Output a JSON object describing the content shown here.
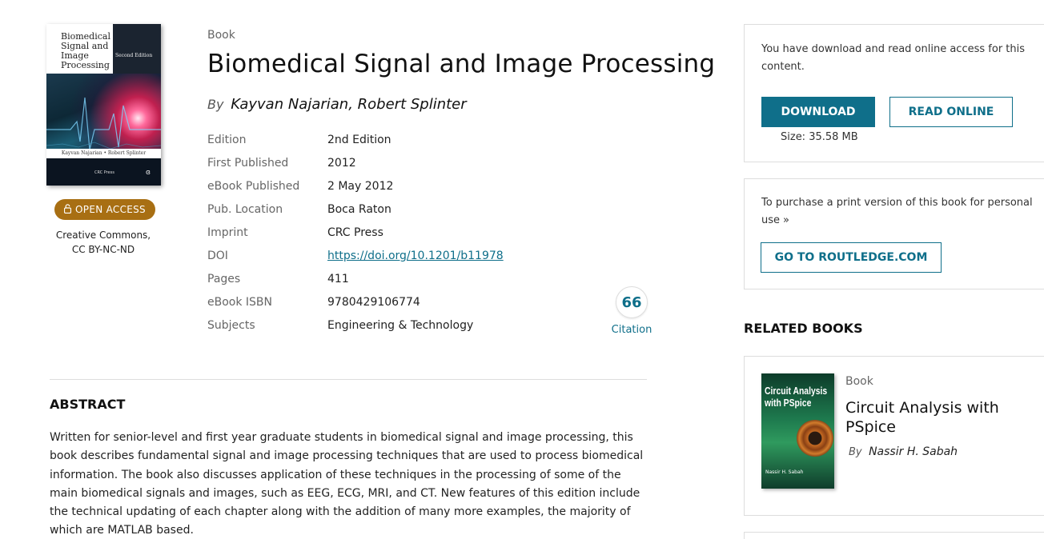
{
  "cover": {
    "title_lines": "Biomedical Signal and Image Processing",
    "edition_text": "Second Edition",
    "authors_text": "Kayvan Najarian • Robert Splinter",
    "publisher_text": "CRC Press"
  },
  "access_badge": {
    "label": "OPEN ACCESS",
    "icon": "lock-open-icon"
  },
  "license": {
    "line1": "Creative Commons,",
    "line2": "CC BY-NC-ND"
  },
  "book": {
    "type": "Book",
    "title": "Biomedical Signal and Image Processing",
    "by_label": "By",
    "authors": "Kayvan Najarian, Robert Splinter"
  },
  "meta": [
    {
      "label": "Edition",
      "value": "2nd Edition"
    },
    {
      "label": "First Published",
      "value": "2012"
    },
    {
      "label": "eBook Published",
      "value": "2 May 2012"
    },
    {
      "label": "Pub. Location",
      "value": "Boca Raton"
    },
    {
      "label": "Imprint",
      "value": "CRC Press"
    },
    {
      "label": "DOI",
      "value": "https://doi.org/10.1201/b11978"
    },
    {
      "label": "Pages",
      "value": "411"
    },
    {
      "label": "eBook ISBN",
      "value": "9780429106774"
    },
    {
      "label": "Subjects",
      "value": "Engineering & Technology"
    }
  ],
  "citation": {
    "label": "Citation",
    "icon": "quote-icon",
    "glyph": "66"
  },
  "abstract": {
    "heading": "ABSTRACT",
    "text": "Written for senior-level and first year graduate students in biomedical signal and image processing, this book describes fundamental signal and image processing techniques that are used to process biomedical information. The book also discusses application of these techniques in the processing of some of the main biomedical signals and images, such as EEG, ECG, MRI, and CT. New features of this edition include the technical updating of each chapter along with the addition of many more examples, the majority of which are MATLAB based."
  },
  "access_panel": {
    "text": "You have download and read online access for this content.",
    "download_label": "DOWNLOAD",
    "read_online_label": "READ ONLINE",
    "size_text": "Size: 35.58 MB"
  },
  "purchase_panel": {
    "text": "To purchase a print version of this book for personal use",
    "chevron": "»",
    "button_label": "GO TO ROUTLEDGE.COM"
  },
  "related": {
    "heading": "RELATED BOOKS",
    "items": [
      {
        "type": "Book",
        "title": "Circuit Analysis with PSpice",
        "by_label": "By",
        "authors": "Nassir H. Sabah",
        "cover_title": "Circuit Analysis with PSpice",
        "cover_author": "Nassir H. Sabah"
      }
    ]
  },
  "colors": {
    "accent": "#0f6f8a",
    "open_access_badge": "#a86f13"
  }
}
